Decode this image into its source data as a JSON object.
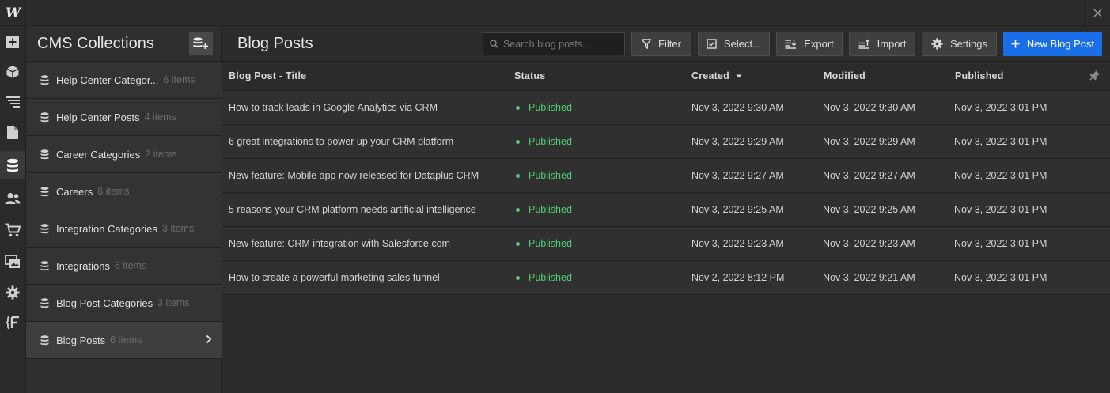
{
  "app": {
    "logo_text": "W"
  },
  "rail": {
    "icons": [
      "add-icon",
      "cube-icon",
      "navigator-icon",
      "pages-icon",
      "cms-icon",
      "users-icon",
      "ecommerce-icon",
      "assets-icon",
      "settings-icon",
      "logic-icon"
    ],
    "active": "cms-icon"
  },
  "collections": {
    "title": "CMS Collections",
    "items": [
      {
        "name": "Help Center Categor...",
        "count": "6 items"
      },
      {
        "name": "Help Center Posts",
        "count": "4 items"
      },
      {
        "name": "Career Categories",
        "count": "2 items"
      },
      {
        "name": "Careers",
        "count": "6 items"
      },
      {
        "name": "Integration Categories",
        "count": "3 items"
      },
      {
        "name": "Integrations",
        "count": "6 items"
      },
      {
        "name": "Blog Post Categories",
        "count": "3 items"
      },
      {
        "name": "Blog Posts",
        "count": "6 items"
      }
    ]
  },
  "main": {
    "title": "Blog Posts",
    "search_placeholder": "Search blog posts...",
    "filter_label": "Filter",
    "select_label": "Select...",
    "export_label": "Export",
    "import_label": "Import",
    "settings_label": "Settings",
    "new_label": "New Blog Post"
  },
  "table": {
    "columns": {
      "title": "Blog Post - Title",
      "status": "Status",
      "created": "Created",
      "modified": "Modified",
      "published": "Published"
    },
    "rows": [
      {
        "title": "How to track leads in Google Analytics via CRM",
        "status": "Published",
        "created": "Nov 3, 2022 9:30 AM",
        "modified": "Nov 3, 2022 9:30 AM",
        "published": "Nov 3, 2022 3:01 PM"
      },
      {
        "title": "6 great integrations to power up your CRM platform",
        "status": "Published",
        "created": "Nov 3, 2022 9:29 AM",
        "modified": "Nov 3, 2022 9:29 AM",
        "published": "Nov 3, 2022 3:01 PM"
      },
      {
        "title": "New feature: Mobile app now released for Dataplus CRM",
        "status": "Published",
        "created": "Nov 3, 2022 9:27 AM",
        "modified": "Nov 3, 2022 9:27 AM",
        "published": "Nov 3, 2022 3:01 PM"
      },
      {
        "title": "5 reasons your CRM platform needs artificial intelligence",
        "status": "Published",
        "created": "Nov 3, 2022 9:25 AM",
        "modified": "Nov 3, 2022 9:25 AM",
        "published": "Nov 3, 2022 3:01 PM"
      },
      {
        "title": "New feature: CRM integration with Salesforce.com",
        "status": "Published",
        "created": "Nov 3, 2022 9:23 AM",
        "modified": "Nov 3, 2022 9:23 AM",
        "published": "Nov 3, 2022 3:01 PM"
      },
      {
        "title": "How to create a powerful marketing sales funnel",
        "status": "Published",
        "created": "Nov 2, 2022 8:12 PM",
        "modified": "Nov 3, 2022 9:21 AM",
        "published": "Nov 3, 2022 3:01 PM"
      }
    ]
  },
  "colors": {
    "accent": "#1a6fe8",
    "published": "#4fcf72",
    "background": "#2b2b2b"
  }
}
